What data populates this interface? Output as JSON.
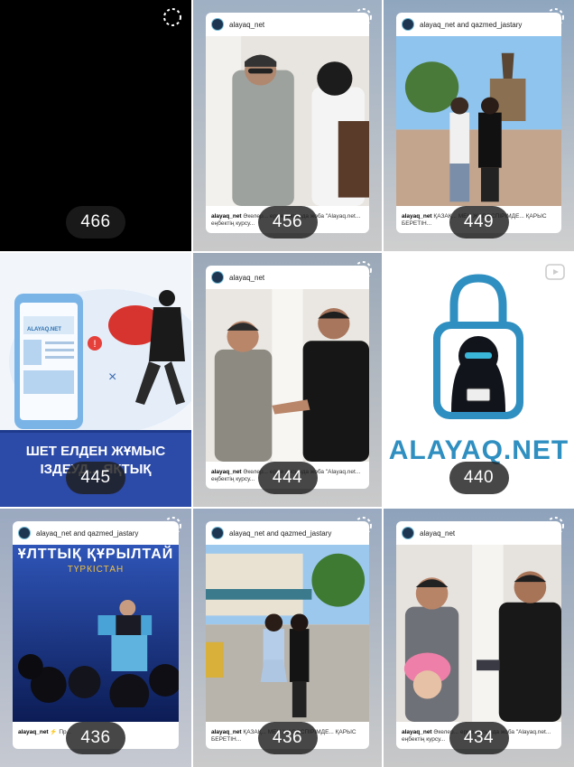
{
  "grid": {
    "tiles": [
      {
        "count": "466"
      },
      {
        "count": "456",
        "account": "alayaq_net",
        "caption_user": "alayaq_net",
        "caption": "Әкелер... ерме аясында жоба \"Alayaq.net... еңбектің курсу..."
      },
      {
        "count": "449",
        "account": "alayaq_net and qazmed_jastary",
        "caption_user": "alayaq_net",
        "caption": "ҚАЗАҚ... МЕН ЖАСӨСПІРІМДЕ... ҚАРЫС БЕРЕТІН..."
      },
      {
        "count": "445",
        "brand": "ALAYAQ.NET",
        "banner_line1": "ШЕТ ЕЛДЕН ЖҰМЫС",
        "banner_line2": "ІЗДЕУД... ЯҚТЫҚ"
      },
      {
        "count": "444",
        "account": "alayaq_net",
        "caption_user": "alayaq_net",
        "caption": "Әкелер... ерме аясында жоба \"Alayaq.net... еңбектің курсу..."
      },
      {
        "count": "440",
        "logo_text": "ALAYAQ.NET"
      },
      {
        "count": "436",
        "account": "alayaq_net and qazmed_jastary",
        "caption_user": "alayaq_net",
        "caption": "⚡ Пр...",
        "title": "ҰЛТТЫҚ ҚҰРЫЛТАЙ",
        "subtitle": "ТҮРКІСТАН"
      },
      {
        "count": "436",
        "account": "alayaq_net and qazmed_jastary",
        "caption_user": "alayaq_net",
        "caption": "ҚАЗАҚ... МЕН ЖАСӨСПІРІМДЕ... ҚАРЫС БЕРЕТІН..."
      },
      {
        "count": "434",
        "account": "alayaq_net",
        "caption_user": "alayaq_net",
        "caption": "Әкелер... ерме аясында жоба \"Alayaq.net... еңбектің курсу..."
      }
    ]
  },
  "colors": {
    "badge": "#1e1e1e",
    "brand_blue": "#2f8fc0",
    "banner_blue": "#2c4aa8"
  }
}
